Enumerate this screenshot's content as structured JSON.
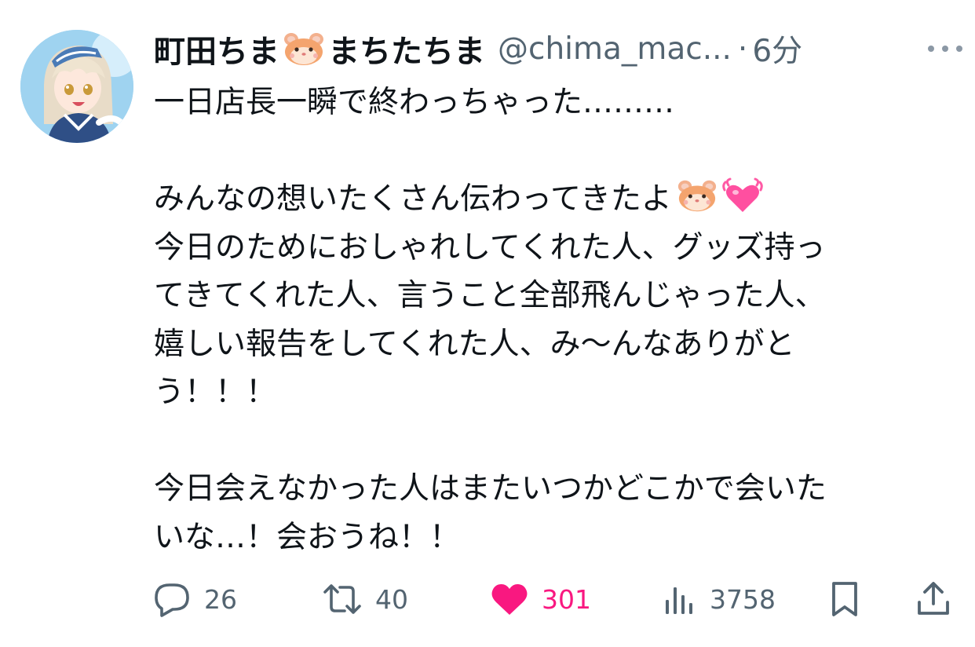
{
  "author": {
    "display_name_part1": "町田ちま",
    "display_name_part2": "まちたちま",
    "name_emoji": "hamster-face-emoji",
    "handle": "@chima_mac...",
    "separator": "·",
    "time": "6分"
  },
  "tweet": {
    "lines": [
      "一日店長一瞬で終わっちゃった………",
      "",
      "みんなの想いたくさん伝わってきたよ",
      "今日のためにおしゃれしてくれた人、グッズ持っ",
      "てきてくれた人、言うこと全部飛んじゃった人、",
      "嬉しい報告をしてくれた人、み〜んなありがと",
      "う！！！",
      "",
      "今日会えなかった人はまたいつかどこかで会いた",
      "いな…！会おうね！！"
    ],
    "line3_emojis": [
      "hamster-face-emoji",
      "beating-heart-emoji"
    ]
  },
  "actions": {
    "reply_count": "26",
    "retweet_count": "40",
    "like_count": "301",
    "views_count": "3758",
    "like_active": true
  },
  "icons": {
    "reply": "reply-icon",
    "retweet": "retweet-icon",
    "like": "heart-icon",
    "views": "views-icon",
    "bookmark": "bookmark-icon",
    "share": "share-icon",
    "more": "more-icon"
  },
  "colors": {
    "text_primary": "#0f1419",
    "text_secondary": "#536471",
    "like_active": "#f91880"
  }
}
